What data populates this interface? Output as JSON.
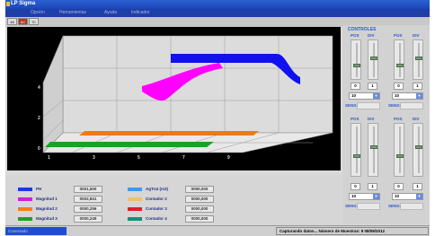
{
  "window": {
    "title": "LP Sigma",
    "menu": [
      "Opción",
      "Herramientas",
      "Ayuda",
      "Indicador"
    ]
  },
  "toolbar": {
    "buttons": [
      "48",
      "AC",
      "TC"
    ]
  },
  "colors": {
    "blue_series": "#0000ff",
    "magenta_series": "#ff00ff",
    "orange_series": "#ff7f00",
    "green_series": "#00a000",
    "accent": "#2a5acc"
  },
  "chart_data": {
    "type": "area",
    "x_ticks": [
      "1",
      "3",
      "5",
      "7",
      "9"
    ],
    "y_ticks": [
      "0",
      "2",
      "4"
    ],
    "grid": true,
    "series": [
      {
        "name": "PH",
        "color": "#0000ff"
      },
      {
        "name": "Magnitud 1",
        "color": "#ff00ff"
      },
      {
        "name": "Magnitud 2",
        "color": "#ff7f00"
      },
      {
        "name": "Magnitud 3",
        "color": "#00a000"
      }
    ]
  },
  "controls": {
    "title": "CONTROLES",
    "groups": [
      {
        "pos": "POS",
        "div": "DIV",
        "val_a": "0",
        "val_b": "1",
        "select": "10",
        "sens": "SENS:"
      },
      {
        "pos": "POS",
        "div": "DIV",
        "val_a": "0",
        "val_b": "1",
        "select": "10",
        "sens": "SENS:"
      },
      {
        "pos": "POS",
        "div": "DIV",
        "val_a": "0",
        "val_b": "1",
        "select": "10",
        "sens": "SENS:"
      },
      {
        "pos": "POS",
        "div": "DIV",
        "val_a": "0",
        "val_b": "1",
        "select": "10",
        "sens": "SENS:"
      }
    ]
  },
  "legend": {
    "left": [
      {
        "label": "PH",
        "value": "0001,500",
        "color": "#1a3ae0"
      },
      {
        "label": "Magnitud 1",
        "value": "0002,841",
        "color": "#d020d0"
      },
      {
        "label": "Magnitud 2",
        "value": "0000,256",
        "color": "#f08020"
      },
      {
        "label": "Magnitud 3",
        "value": "0000,249",
        "color": "#20a020"
      }
    ],
    "right": [
      {
        "label": "AgTrat (m3)",
        "value": "0000,000",
        "color": "#3a9af0"
      },
      {
        "label": "Contador 2",
        "value": "0000,000",
        "color": "#f0c070"
      },
      {
        "label": "Contador 3",
        "value": "0000,000",
        "color": "#e02020"
      },
      {
        "label": "Contador 4",
        "value": "0000,000",
        "color": "#10907a"
      }
    ]
  },
  "status": {
    "left": "Conectado",
    "right": "Capturando datos... Número de Muestras: 9 08/08/2012"
  }
}
